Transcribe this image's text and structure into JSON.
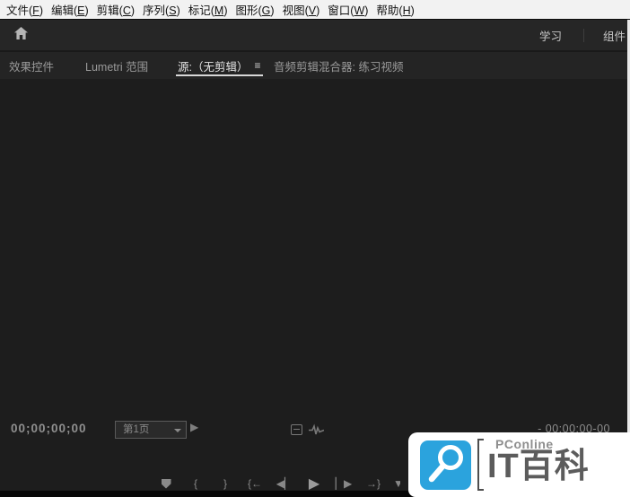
{
  "menu_bar": {
    "items": [
      {
        "name": "menu-file",
        "text": "文件",
        "key": "F"
      },
      {
        "name": "menu-edit",
        "text": "编辑",
        "key": "E"
      },
      {
        "name": "menu-clip",
        "text": "剪辑",
        "key": "C"
      },
      {
        "name": "menu-sequence",
        "text": "序列",
        "key": "S"
      },
      {
        "name": "menu-markers",
        "text": "标记",
        "key": "M"
      },
      {
        "name": "menu-graphics",
        "text": "图形",
        "key": "G"
      },
      {
        "name": "menu-view",
        "text": "视图",
        "key": "V"
      },
      {
        "name": "menu-window",
        "text": "窗口",
        "key": "W"
      },
      {
        "name": "menu-help",
        "text": "帮助",
        "key": "H"
      }
    ]
  },
  "toolbar": {
    "learn_label": "学习",
    "components_label": "组件"
  },
  "tab_bar": {
    "tabs": [
      {
        "name": "tab-effect-controls",
        "label": "效果控件",
        "active": false
      },
      {
        "name": "tab-lumetri-scopes",
        "label": "Lumetri 范围",
        "active": false
      },
      {
        "name": "tab-source-monitor",
        "label": "源:（无剪辑）",
        "active": true,
        "panel_menu_icon": "≡"
      },
      {
        "name": "tab-audio-clip-mixer",
        "label": "音频剪辑混合器: 练习视频",
        "active": false
      }
    ]
  },
  "monitor": {
    "current_timecode": "00;00;00;00",
    "zoom_select_value": "第1页",
    "duration_timecode": "- 00:00:00-00"
  },
  "transport": {
    "buttons": [
      {
        "name": "add-marker-button",
        "glyph": "",
        "shape": "pentagon-down"
      },
      {
        "name": "mark-in-button",
        "glyph": "{"
      },
      {
        "name": "mark-out-button",
        "glyph": "}"
      },
      {
        "name": "go-to-in-button",
        "glyph": "{←"
      },
      {
        "name": "step-back-button",
        "glyph": "◀▏"
      },
      {
        "name": "play-button",
        "glyph": "▶"
      },
      {
        "name": "step-forward-button",
        "glyph": "▏▶"
      },
      {
        "name": "go-to-out-button",
        "glyph": "→}"
      },
      {
        "name": "insert-button",
        "glyph": "▼",
        "clipped": true
      }
    ]
  },
  "watermark": {
    "brand": "PConline",
    "title": "IT百科",
    "accent_color": "#2ba3dd"
  }
}
